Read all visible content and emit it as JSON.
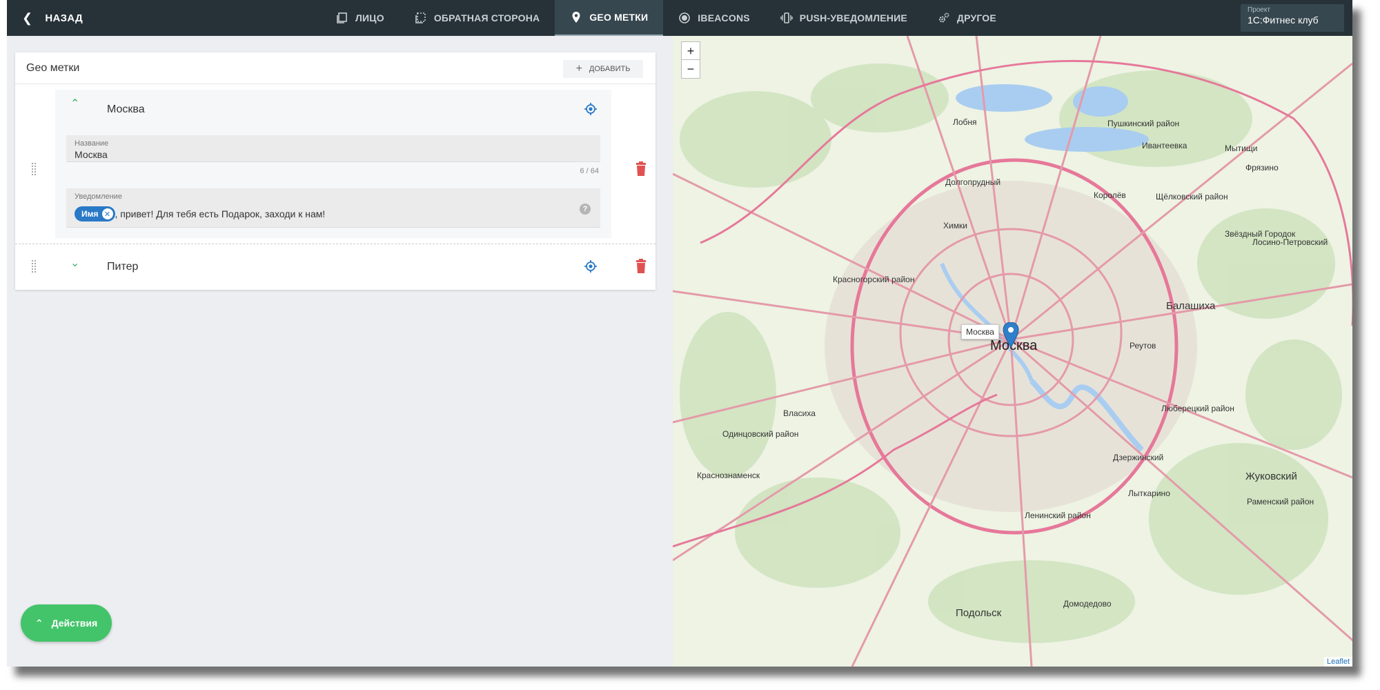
{
  "topbar": {
    "back_label": "НАЗАД",
    "tabs": [
      {
        "label": "ЛИЦО",
        "icon": "card-front-icon"
      },
      {
        "label": "ОБРАТНАЯ СТОРОНА",
        "icon": "card-back-icon"
      },
      {
        "label": "GEO МЕТКИ",
        "icon": "map-pin-icon",
        "active": true
      },
      {
        "label": "IBEACONS",
        "icon": "beacon-icon"
      },
      {
        "label": "PUSH-УВЕДОМЛЕНИЕ",
        "icon": "vibrate-phone-icon"
      },
      {
        "label": "ДРУГОЕ",
        "icon": "gears-icon"
      }
    ],
    "project_label": "Проект",
    "project_value": "1С:Фитнес клуб"
  },
  "panel": {
    "title": "Geo метки",
    "add_label": "ДОБАВИТЬ",
    "locations": [
      {
        "name": "Москва",
        "expanded": true,
        "name_field_label": "Название",
        "name_field_value": "Москва",
        "counter": "6 / 64",
        "notification_label": "Уведомление",
        "chip_label": "Имя",
        "notification_text": ", привет! Для тебя есть Подарок, заходи к нам!"
      },
      {
        "name": "Питер",
        "expanded": false
      }
    ]
  },
  "actions_label": "Действия",
  "map": {
    "zoom_in": "+",
    "zoom_out": "−",
    "tooltip": "Москва",
    "attribution": "Leaflet",
    "places": [
      "Москва",
      "Балашиха",
      "Химки",
      "Долгопрудный",
      "Королёв",
      "Мытищи",
      "Лобня",
      "Пушкинский район",
      "Ивантеевка",
      "Фрязино",
      "Щёлковский район",
      "Звёздный Городок",
      "Лосино-Петровский",
      "Красногорский район",
      "Реутов",
      "Люберецкий район",
      "Одинцовский район",
      "Власиха",
      "Краснознаменск",
      "Дзержинский",
      "Лыткарино",
      "Жуковский",
      "Раменский район",
      "Ленинский район",
      "Подольск",
      "Домодедово"
    ]
  }
}
